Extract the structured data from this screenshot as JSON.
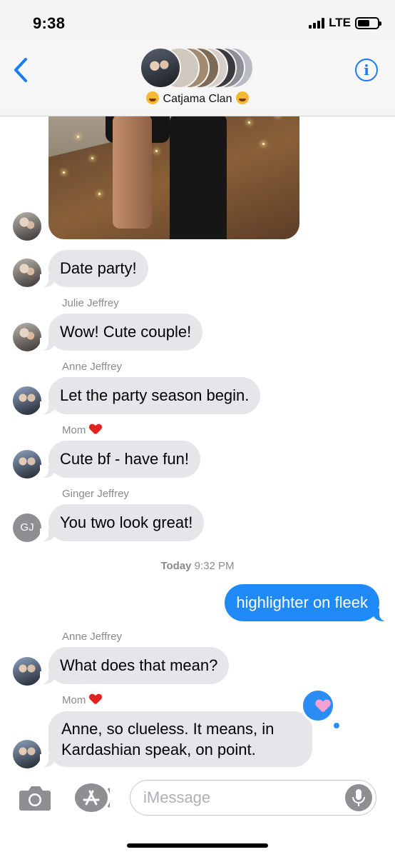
{
  "status_bar": {
    "time": "9:38",
    "network": "LTE"
  },
  "conversation": {
    "title": "Catjama Clan"
  },
  "messages": [
    {
      "text": "Date party!"
    },
    {
      "sender": "Julie Jeffrey",
      "text": "Wow! Cute couple!"
    },
    {
      "sender": "Anne Jeffrey",
      "text": "Let the party season begin."
    },
    {
      "sender": "Mom",
      "text": "Cute bf - have fun!"
    },
    {
      "sender": "Ginger Jeffrey",
      "initials": "GJ",
      "text": "You two look great!"
    },
    {
      "text": "highlighter on fleek",
      "from_me": true
    },
    {
      "sender": "Anne Jeffrey",
      "text": "What does that mean?"
    },
    {
      "sender": "Mom",
      "text": "Anne, so clueless.  It means, in Kardashian speak, on point."
    }
  ],
  "timestamp": {
    "day": "Today",
    "time": "9:32 PM"
  },
  "input": {
    "placeholder": "iMessage"
  },
  "colors": {
    "accent": "#1f8af7",
    "received_bubble": "#e5e5ea"
  }
}
